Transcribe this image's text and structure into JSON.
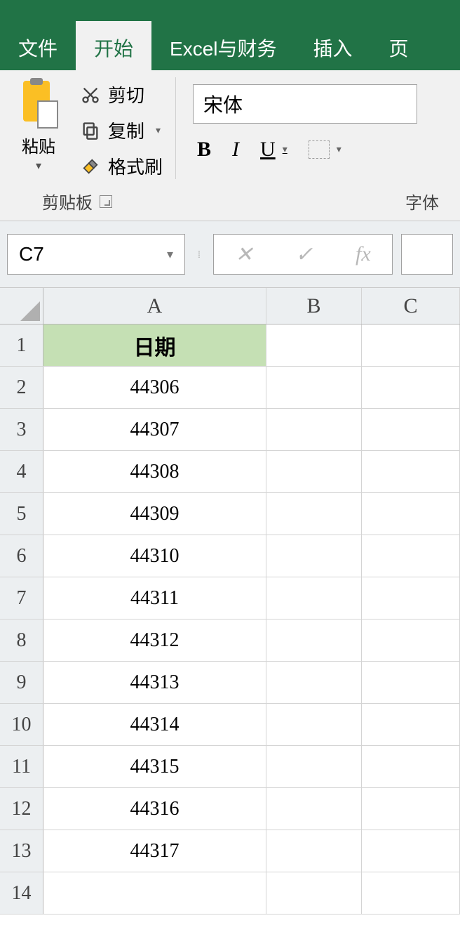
{
  "tabs": {
    "file": "文件",
    "home": "开始",
    "excel_finance": "Excel与财务",
    "insert": "插入",
    "page": "页"
  },
  "ribbon": {
    "paste": "粘贴",
    "cut": "剪切",
    "copy": "复制",
    "format_painter": "格式刷",
    "clipboard_label": "剪贴板",
    "font_label": "字体",
    "font_name": "宋体",
    "bold": "B",
    "italic": "I",
    "underline": "U"
  },
  "namebox": "C7",
  "fx": {
    "cancel": "✕",
    "enter": "✓",
    "fx": "fx"
  },
  "columns": {
    "A": "A",
    "B": "B",
    "C": "C"
  },
  "sheet": {
    "header": "日期",
    "rows": [
      {
        "n": "1"
      },
      {
        "n": "2",
        "a": "44306"
      },
      {
        "n": "3",
        "a": "44307"
      },
      {
        "n": "4",
        "a": "44308"
      },
      {
        "n": "5",
        "a": "44309"
      },
      {
        "n": "6",
        "a": "44310"
      },
      {
        "n": "7",
        "a": "44311"
      },
      {
        "n": "8",
        "a": "44312"
      },
      {
        "n": "9",
        "a": "44313"
      },
      {
        "n": "10",
        "a": "44314"
      },
      {
        "n": "11",
        "a": "44315"
      },
      {
        "n": "12",
        "a": "44316"
      },
      {
        "n": "13",
        "a": "44317"
      },
      {
        "n": "14",
        "a": ""
      }
    ]
  }
}
